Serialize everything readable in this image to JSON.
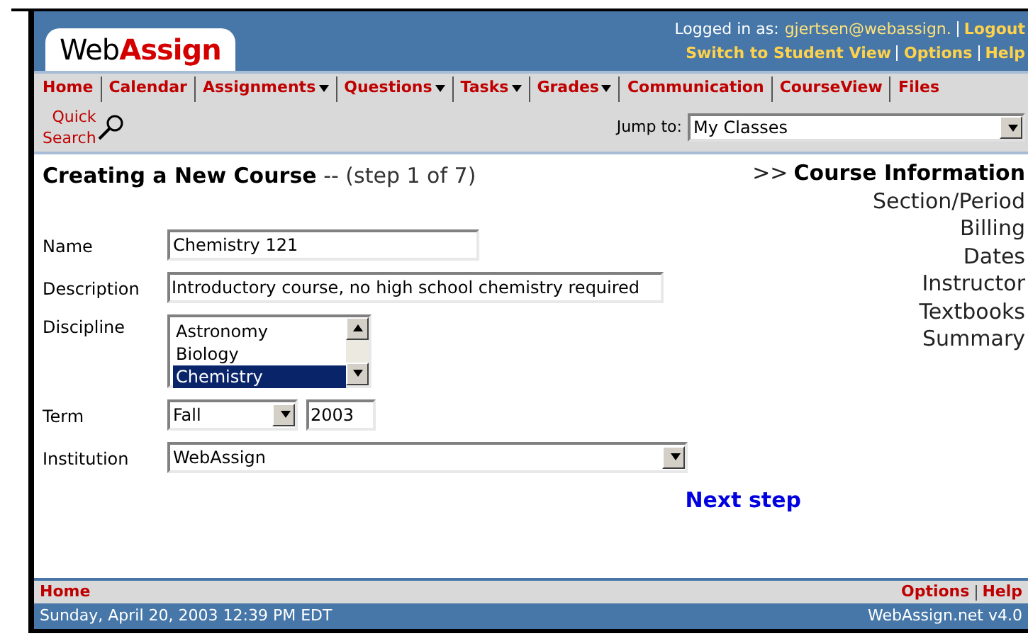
{
  "header": {
    "logo_part_1": "Web",
    "logo_part_2": "Assign",
    "logged_in_label": "Logged in as:",
    "user": "gjertsen@webassign.",
    "logout": "Logout",
    "links": [
      "Switch to Student View",
      "Options",
      "Help"
    ]
  },
  "nav": [
    {
      "label": "Home",
      "has_menu": false
    },
    {
      "label": "Calendar",
      "has_menu": false
    },
    {
      "label": "Assignments",
      "has_menu": true
    },
    {
      "label": "Questions",
      "has_menu": true
    },
    {
      "label": "Tasks",
      "has_menu": true
    },
    {
      "label": "Grades",
      "has_menu": true
    },
    {
      "label": "Communication",
      "has_menu": false
    },
    {
      "label": "CourseView",
      "has_menu": false
    },
    {
      "label": "Files",
      "has_menu": false
    }
  ],
  "quick_search": {
    "line_1": "Quick",
    "line_2": "Search"
  },
  "jump_to": {
    "label": "Jump to:",
    "value": "My Classes"
  },
  "page": {
    "title": "Creating a New Course",
    "step": "-- (step 1 of 7)",
    "marker": ">>"
  },
  "steps": [
    {
      "label": "Course Information",
      "selected": true
    },
    {
      "label": "Section/Period",
      "selected": false
    },
    {
      "label": "Billing",
      "selected": false
    },
    {
      "label": "Dates",
      "selected": false
    },
    {
      "label": "Instructor",
      "selected": false
    },
    {
      "label": "Textbooks",
      "selected": false
    },
    {
      "label": "Summary",
      "selected": false
    }
  ],
  "form": {
    "name": {
      "label": "Name",
      "value": "Chemistry 121"
    },
    "description": {
      "label": "Description",
      "value": "Introductory course, no high school chemistry required"
    },
    "discipline": {
      "label": "Discipline",
      "options": [
        {
          "label": "Astronomy",
          "selected": false
        },
        {
          "label": "Biology",
          "selected": false
        },
        {
          "label": "Chemistry",
          "selected": true
        }
      ]
    },
    "term": {
      "label": "Term",
      "value": "Fall",
      "year": "2003"
    },
    "institution": {
      "label": "Institution",
      "value": "WebAssign"
    },
    "next": "Next step"
  },
  "footer": {
    "home": "Home",
    "links": [
      "Options",
      "Help"
    ],
    "date": "Sunday, April 20, 2003 12:39 PM EDT",
    "version": "WebAssign.net v4.0"
  }
}
